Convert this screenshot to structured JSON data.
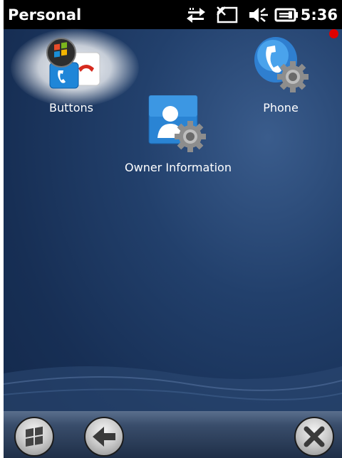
{
  "status_bar": {
    "title": "Personal",
    "time": "5:36",
    "icons": [
      "sync-icon",
      "no-sim-icon",
      "volume-mute-icon",
      "battery-charging-icon"
    ]
  },
  "apps": [
    {
      "label": "Buttons",
      "icon": "buttons-icon",
      "selected": true
    },
    {
      "label": "Phone",
      "icon": "phone-settings-icon",
      "selected": false
    },
    {
      "label": "Owner Information",
      "icon": "owner-information-icon",
      "selected": false
    }
  ],
  "bottom_bar": {
    "buttons": [
      "windows-start-icon",
      "back-arrow-icon",
      "close-icon"
    ]
  },
  "colors": {
    "background": "#172f55",
    "status_bar": "#000000",
    "marker": "#e00000"
  }
}
